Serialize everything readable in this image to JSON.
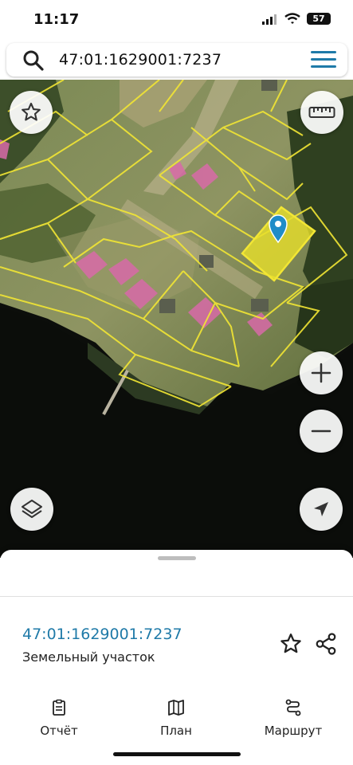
{
  "status": {
    "time": "11:17",
    "battery": "57"
  },
  "search": {
    "query": "47:01:1629001:7237"
  },
  "parcel": {
    "cadastral_number": "47:01:1629001:7237",
    "type": "Земельный участок"
  },
  "tabs": [
    {
      "label": "Отчёт",
      "icon": "report-icon"
    },
    {
      "label": "План",
      "icon": "map-plan-icon"
    },
    {
      "label": "Маршрут",
      "icon": "route-icon"
    }
  ],
  "colors": {
    "parcel_border": "#f2e634",
    "selected_fill": "#e8e02a",
    "building": "#d86aa8",
    "accent": "#1f7aa8",
    "marker": "#1f8cc8"
  },
  "icons": {
    "map_buttons": [
      "star-icon",
      "ruler-icon",
      "zoom-in-icon",
      "zoom-out-icon",
      "layers-icon",
      "locate-icon"
    ]
  }
}
